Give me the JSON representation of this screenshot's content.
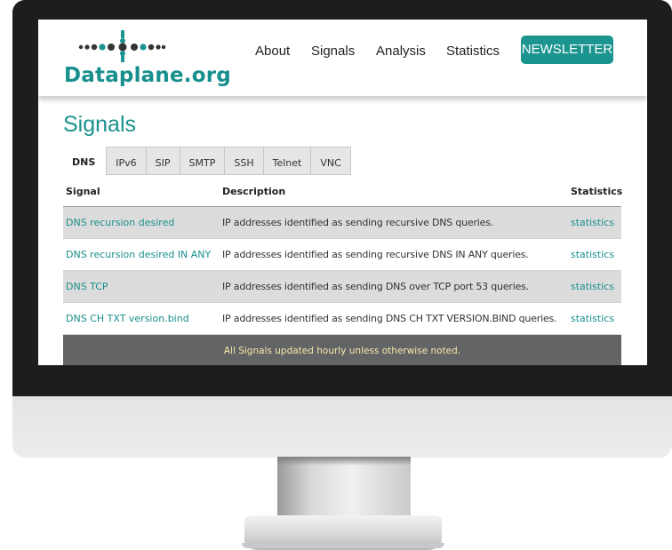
{
  "site": {
    "logo_text": "Dataplane.org",
    "brand_color": "#1c9590",
    "nav": [
      "About",
      "Signals",
      "Analysis",
      "Statistics"
    ],
    "newsletter_label": "NEWSLETTER"
  },
  "main": {
    "title": "Signals",
    "tabs": [
      "DNS",
      "IPv6",
      "SIP",
      "SMTP",
      "SSH",
      "Telnet",
      "VNC"
    ],
    "active_tab": "DNS",
    "table": {
      "headers": [
        "Signal",
        "Description",
        "Statistics"
      ],
      "rows": [
        {
          "signal": "DNS recursion desired",
          "description": "IP addresses identified as sending recursive DNS queries.",
          "stats": "statistics"
        },
        {
          "signal": "DNS recursion desired IN ANY",
          "description": "IP addresses identified as sending recursive DNS IN ANY queries.",
          "stats": "statistics"
        },
        {
          "signal": "DNS TCP",
          "description": "IP addresses identified as sending DNS over TCP port 53 queries.",
          "stats": "statistics"
        },
        {
          "signal": "DNS CH TXT version.bind",
          "description": "IP addresses identified as sending DNS CH TXT VERSION.BIND queries.",
          "stats": "statistics"
        }
      ],
      "footer": "All Signals updated hourly unless otherwise noted."
    }
  }
}
